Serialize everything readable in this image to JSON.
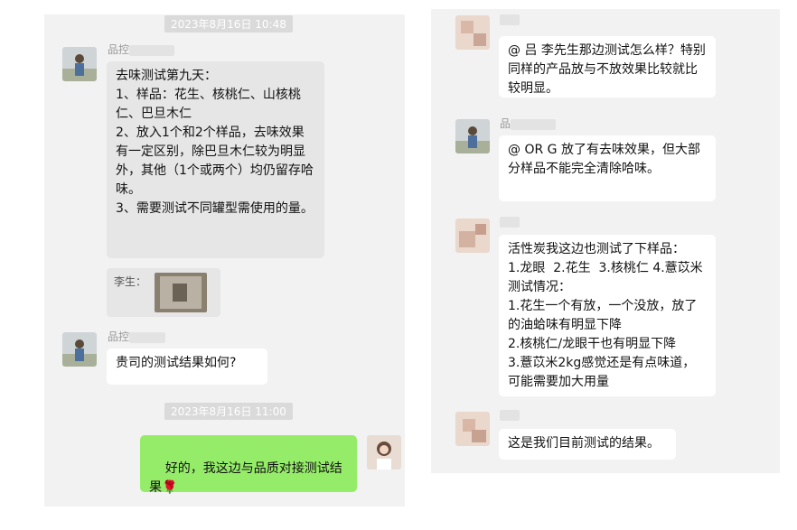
{
  "left": {
    "timestamp1": "2023年8月16日 10:48",
    "sender1_name": "品控",
    "msg1": "去味测试第九天：\n1、样品：花生、核桃仁、山核桃仁、巴旦木仁\n2、放入1个和2个样品，去味效果有一定区别，除巴旦木仁较为明显外，其他（1个或两个）均仍留存哈味。\n3、需要测试不同罐型需使用的量。",
    "quote_label": "李生：",
    "sender2_name": "品控",
    "msg2": "贵司的测试结果如何?",
    "timestamp2": "2023年8月16日 11:00",
    "msg3": "好的，我这边与品质对接测试结果",
    "msg3_emoji": "🌹"
  },
  "right": {
    "msg1": "@ 吕 李先生那边测试怎么样？特别同样的产品放与不放效果比较就比较明显。",
    "sender2_name": "品",
    "msg2": "@ OR G 放了有去味效果，但大部分样品不能完全清除哈味。",
    "msg3": "活性炭我这边也测试了下样品：\n1.龙眼  2.花生  3.核桃仁 4.薏苡米\n测试情况：\n1.花生一个有放，一个没放，放了的油蛤味有明显下降\n2.核桃仁/龙眼干也有明显下降\n3.薏苡米2kg感觉还是有点味道，可能需要加大用量",
    "msg4": "这是我们目前测试的结果。"
  }
}
